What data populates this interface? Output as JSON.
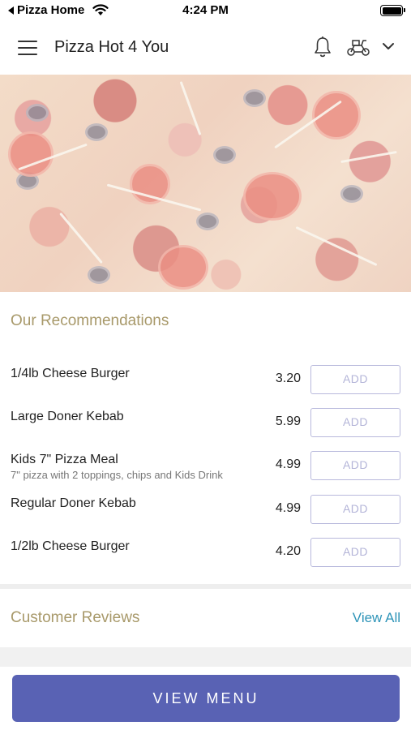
{
  "status_bar": {
    "carrier": "Pizza Home",
    "time": "4:24 PM"
  },
  "header": {
    "title": "Pizza Hot 4 You",
    "icons": [
      "menu-icon",
      "bell-icon",
      "scooter-icon",
      "chevron-down-icon"
    ]
  },
  "recommendations": {
    "title": "Our Recommendations",
    "items": [
      {
        "name": "1/4lb Cheese Burger",
        "description": "",
        "price": "3.20",
        "button": "ADD"
      },
      {
        "name": "Large Doner Kebab",
        "description": "",
        "price": "5.99",
        "button": "ADD"
      },
      {
        "name": "Kids 7\" Pizza Meal",
        "description": "7\" pizza with 2 toppings, chips and Kids Drink",
        "price": "4.99",
        "button": "ADD"
      },
      {
        "name": "Regular Doner Kebab",
        "description": "",
        "price": "4.99",
        "button": "ADD"
      },
      {
        "name": "1/2lb Cheese Burger",
        "description": "",
        "price": "4.20",
        "button": "ADD"
      }
    ]
  },
  "reviews": {
    "title": "Customer Reviews",
    "view_all": "View All"
  },
  "footer": {
    "cta": "VIEW MENU"
  },
  "colors": {
    "accent": "#5962b4",
    "section_title": "#a8996a",
    "link": "#2e94b8"
  }
}
